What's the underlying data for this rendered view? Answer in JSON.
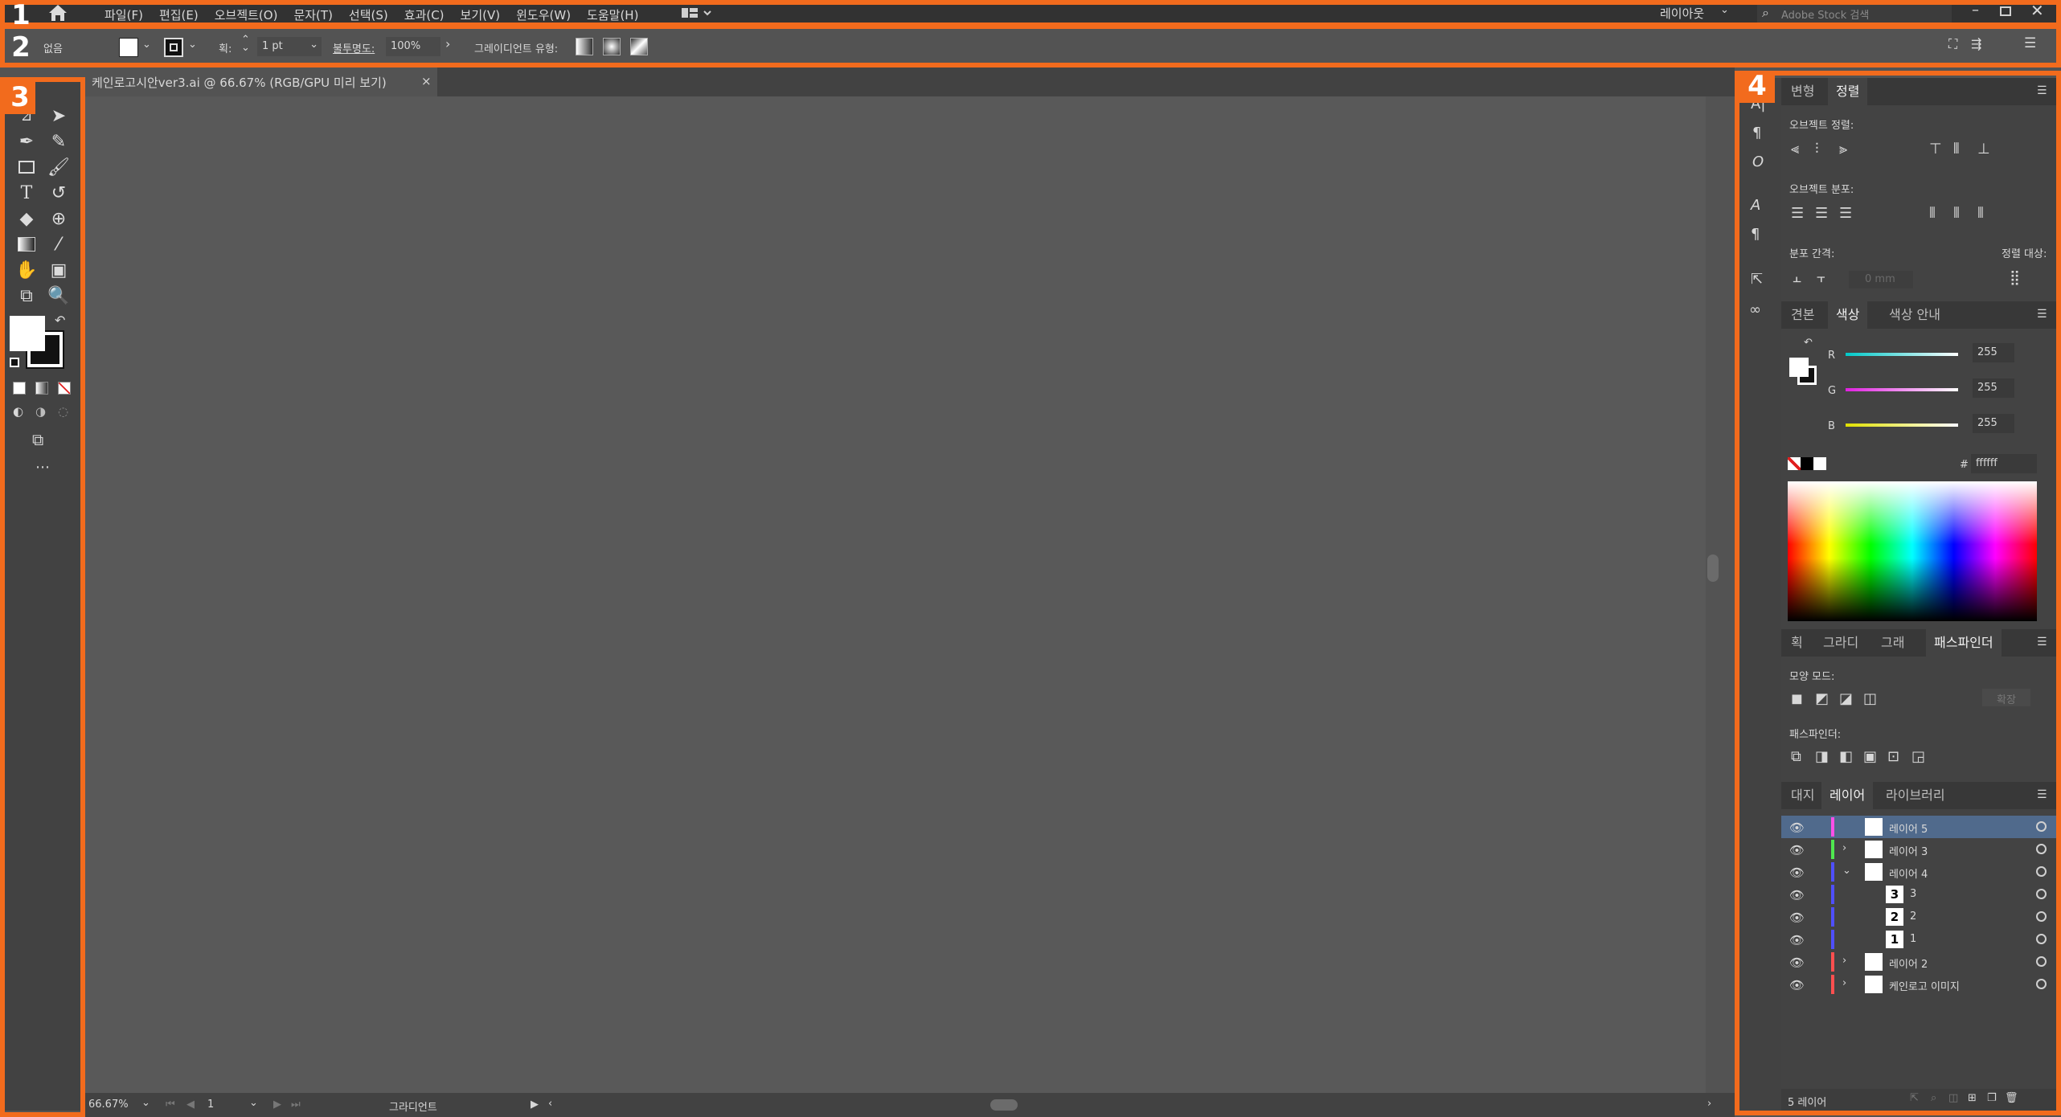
{
  "menubar": {
    "items": [
      "파일(F)",
      "편집(E)",
      "오브젝트(O)",
      "문자(T)",
      "선택(S)",
      "효과(C)",
      "보기(V)",
      "윈도우(W)",
      "도움말(H)"
    ],
    "workspace": "레이아웃",
    "search_placeholder": "Adobe Stock 검색"
  },
  "optionbar": {
    "selection": "없음",
    "stroke_label": "획:",
    "stroke_value": "1 pt",
    "opacity_label": "불투명도:",
    "opacity_value": "100%",
    "gradient_type_label": "그레이디언트 유형:"
  },
  "document": {
    "tab_title": "케인로고시안ver3.ai @ 66.67% (RGB/GPU 미리 보기)",
    "zoom": "66.67%",
    "artboard": "1",
    "status_tool": "그라디언트"
  },
  "badges": [
    "1",
    "2",
    "3",
    "4"
  ],
  "panels": {
    "align_tabs": [
      "변형",
      "정렬"
    ],
    "align_objects_label": "오브젝트 정렬:",
    "distribute_objects_label": "오브젝트 분포:",
    "distribute_spacing_label": "분포 간격:",
    "align_to_label": "정렬 대상:",
    "spacing_value": "0 mm",
    "color_tabs": [
      "견본",
      "색상",
      "색상 안내"
    ],
    "color": {
      "r_label": "R",
      "g_label": "G",
      "b_label": "B",
      "r": "255",
      "g": "255",
      "b": "255",
      "hex_label": "#",
      "hex": "ffffff"
    },
    "pathfinder_tabs": [
      "획",
      "그라디언트",
      "그래픽",
      "패스파인더"
    ],
    "shape_modes_label": "모양 모드:",
    "expand_label": "확장",
    "pathfinders_label": "패스파인더:",
    "layer_tabs": [
      "대지",
      "레이어",
      "라이브러리"
    ],
    "layers": [
      {
        "name": "레이어 5",
        "color": "#ff4fe8",
        "selected": true,
        "indent": 0
      },
      {
        "name": "레이어 3",
        "color": "#4fe84f",
        "selected": false,
        "indent": 0
      },
      {
        "name": "레이어 4",
        "color": "#4f4fff",
        "selected": false,
        "indent": 0
      },
      {
        "name": "3",
        "color": "#4f4fff",
        "selected": false,
        "indent": 1
      },
      {
        "name": "2",
        "color": "#4f4fff",
        "selected": false,
        "indent": 1
      },
      {
        "name": "1",
        "color": "#4f4fff",
        "selected": false,
        "indent": 1
      },
      {
        "name": "레이어 2",
        "color": "#ff4f4f",
        "selected": false,
        "indent": 0
      },
      {
        "name": "케인로고 이미지",
        "color": "#ff4f4f",
        "selected": false,
        "indent": 0
      }
    ],
    "layer_count": "5 레이어"
  },
  "colors": {
    "accent": "#f26b1d",
    "panel_bg": "#434343",
    "canvas_bg": "#595959"
  }
}
